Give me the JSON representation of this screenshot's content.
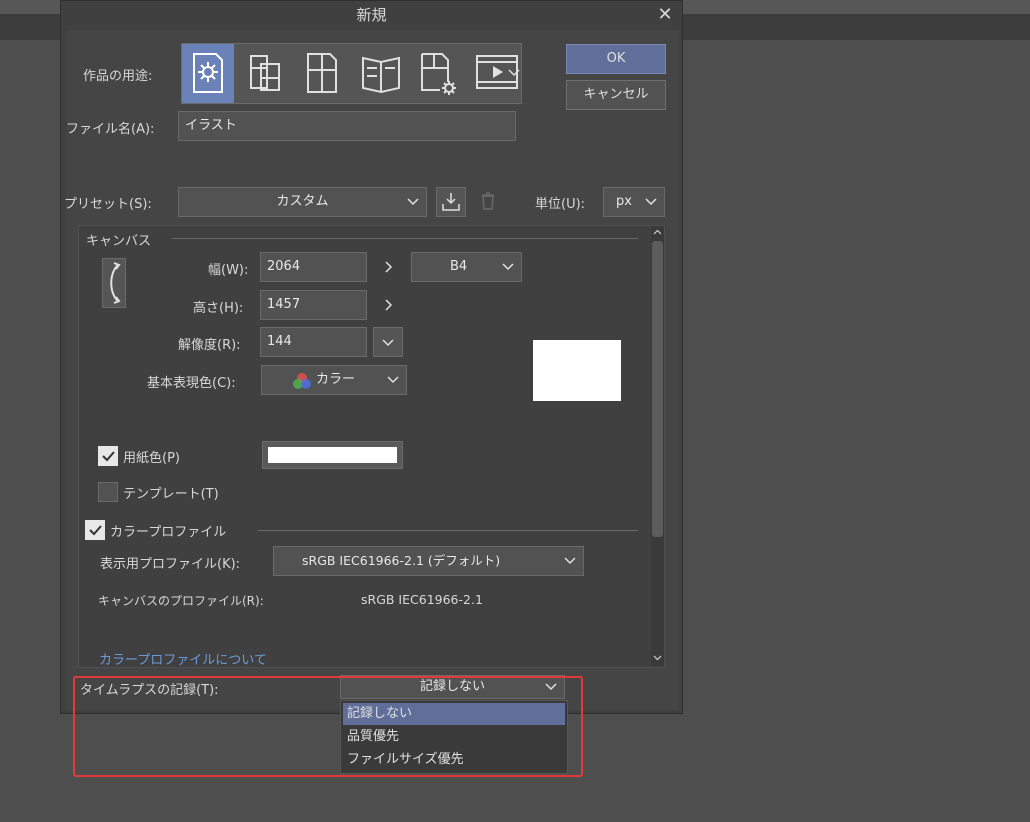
{
  "dialog": {
    "title": "新規",
    "ok_label": "OK",
    "cancel_label": "キャンセル"
  },
  "purpose": {
    "label": "作品の用途:",
    "icons": [
      "illustration-icon",
      "webtoon-icon",
      "comic-icon",
      "book-icon",
      "custom-settings-icon",
      "animation-icon"
    ],
    "selected_index": 0
  },
  "filename": {
    "label": "ファイル名(A):",
    "value": "イラスト"
  },
  "preset": {
    "label": "プリセット(S):",
    "value": "カスタム"
  },
  "unit": {
    "label": "単位(U):",
    "value": "px"
  },
  "canvas": {
    "section_label": "キャンバス",
    "width_label": "幅(W):",
    "width_value": "2064",
    "height_label": "高さ(H):",
    "height_value": "1457",
    "resolution_label": "解像度(R):",
    "resolution_value": "144",
    "size_preset": "B4",
    "color_mode_label": "基本表現色(C):",
    "color_mode_value": "カラー",
    "paper_color_label": "用紙色(P)",
    "paper_color_checked": true,
    "paper_color": "#ffffff",
    "template_label": "テンプレート(T)",
    "template_checked": false
  },
  "color_profile": {
    "section_label": "カラープロファイル",
    "checked": true,
    "display_label": "表示用プロファイル(K):",
    "display_value": "sRGB IEC61966-2.1 (デフォルト)",
    "canvas_label": "キャンバスのプロファイル(R):",
    "canvas_value": "sRGB IEC61966-2.1",
    "about_link": "カラープロファイルについて"
  },
  "timelapse": {
    "label": "タイムラプスの記録(T):",
    "value": "記録しない",
    "options": [
      "記録しない",
      "品質優先",
      "ファイルサイズ優先"
    ],
    "selected_index": 0
  },
  "colors": {
    "accent": "#5f6f99",
    "highlight": "#e03a3a",
    "link": "#6b9ad8"
  }
}
